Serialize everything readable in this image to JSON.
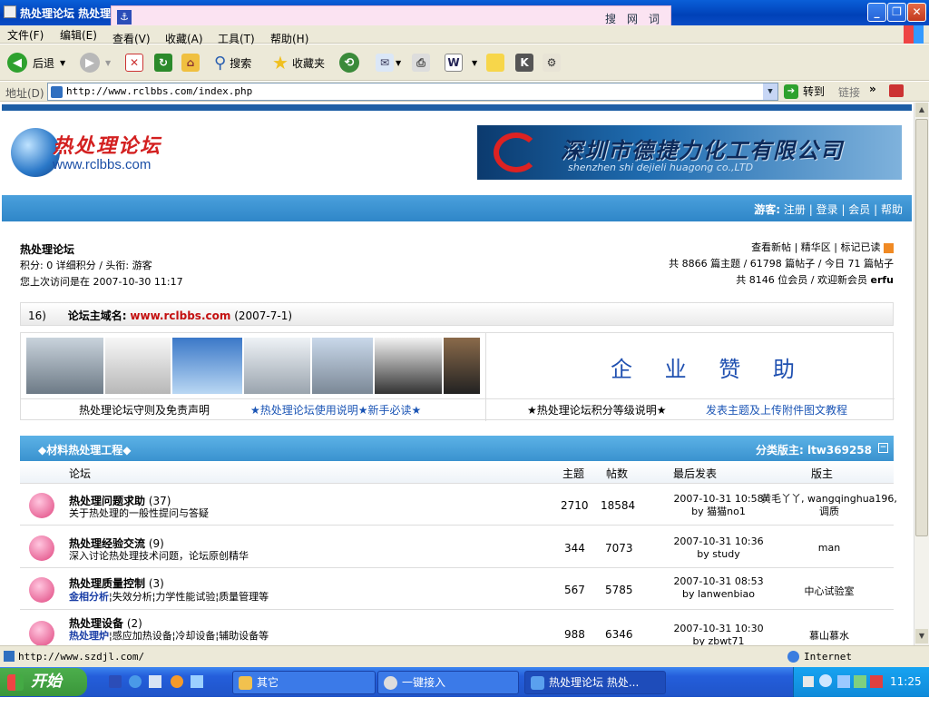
{
  "window": {
    "title": "热处理论坛 热处理"
  },
  "dict": {
    "search_label": "搜网词"
  },
  "menu": [
    "文件(F)",
    "编辑(E)",
    "查看(V)",
    "收藏(A)",
    "工具(T)",
    "帮助(H)"
  ],
  "toolbar": {
    "back": "后退",
    "search": "搜索",
    "favorites": "收藏夹"
  },
  "address": {
    "label": "地址(D)",
    "url": "http://www.rclbbs.com/index.php",
    "go": "转到",
    "links": "链接"
  },
  "site": {
    "logo_cn": "热处理论坛",
    "logo_url": "www.rclbbs.com",
    "banner_text": "深圳市德捷力化工有限公司",
    "banner_sub": "shenzhen shi dejieli huagong co.,LTD",
    "nav": {
      "guest": "游客:",
      "register": "注册",
      "login": "登录",
      "members": "会员",
      "help": "帮助"
    },
    "user": {
      "forum_name": "热处理论坛",
      "points": "积分: 0 详细积分 / 头衔: 游客",
      "last_visit": "您上次访问是在 2007-10-30 11:17"
    },
    "stats": {
      "links": "查看新帖 | 精华区 | 标记已读",
      "line1": "共 8866 篇主题 / 61798 篇帖子 / 今日 71 篇帖子",
      "line2": "共 8146 位会员 / 欢迎新会员 ",
      "newest_member": "erfu"
    },
    "announce": {
      "num": "16)",
      "label": "论坛主域名:",
      "domain": "www.rclbbs.com",
      "date": "(2007-7-1)"
    },
    "sponsor": "企 业 赞 助",
    "notice_links": [
      "热处理论坛守则及免责声明",
      "★热处理论坛使用说明★新手必读★",
      "★热处理论坛积分等级说明★",
      "发表主题及上传附件图文教程"
    ]
  },
  "category": {
    "title": "◆材料热处理工程◆",
    "moderator": "分类版主: ltw369258"
  },
  "table": {
    "headers": [
      "论坛",
      "主题",
      "帖数",
      "最后发表",
      "版主"
    ]
  },
  "forums": [
    {
      "name": "热处理问题求助",
      "count": "(37)",
      "desc": "关于热处理的一般性提问与答疑",
      "topics": "2710",
      "posts": "18584",
      "last_date": "2007-10-31 10:58",
      "last_by": "by 猫猫no1",
      "mod": "黄毛丫丫, wangqinghua196, 调质"
    },
    {
      "name": "热处理经验交流",
      "count": "(9)",
      "desc": "深入讨论热处理技术问题，论坛原创精华",
      "topics": "344",
      "posts": "7073",
      "last_date": "2007-10-31 10:36",
      "last_by": "by study",
      "mod": "man"
    },
    {
      "name": "热处理质量控制",
      "count": "(3)",
      "desc_bold": "金相分析",
      "desc": "¦失效分析¦力学性能试验¦质量管理等",
      "topics": "567",
      "posts": "5785",
      "last_date": "2007-10-31 08:53",
      "last_by": "by lanwenbiao",
      "mod": "中心试验室"
    },
    {
      "name": "热处理设备",
      "count": "(2)",
      "desc_bold": "热处理炉",
      "desc": "¦感应加热设备¦冷却设备¦辅助设备等",
      "topics": "988",
      "posts": "6346",
      "last_date": "2007-10-31 10:30",
      "last_by": "by zbwt71",
      "mod": "慕山慕水"
    }
  ],
  "status": {
    "url": "http://www.szdjl.com/",
    "zone": "Internet"
  },
  "taskbar": {
    "start": "开始",
    "tasks": [
      "其它",
      "一键接入",
      "热处理论坛 热处..."
    ],
    "clock": "11:25"
  }
}
